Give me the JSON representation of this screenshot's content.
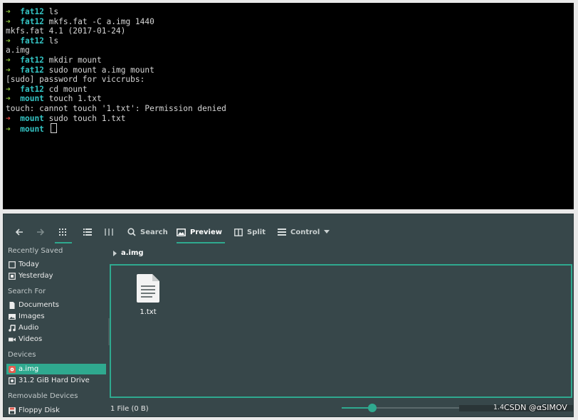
{
  "terminal": {
    "arrow_glyph": "➜",
    "lines": [
      {
        "dir": "fat12",
        "cmd": "ls",
        "arrow_color": "#8ec23e"
      },
      {
        "dir": "fat12",
        "cmd": "mkfs.fat -C a.img 1440",
        "arrow_color": "#8ec23e"
      },
      {
        "out": "mkfs.fat 4.1 (2017-01-24)"
      },
      {
        "dir": "fat12",
        "cmd": "ls",
        "arrow_color": "#8ec23e"
      },
      {
        "out": "a.img"
      },
      {
        "dir": "fat12",
        "cmd": "mkdir mount",
        "arrow_color": "#8ec23e"
      },
      {
        "dir": "fat12",
        "cmd": "sudo mount a.img mount",
        "arrow_color": "#8ec23e"
      },
      {
        "out": "[sudo] password for viccrubs:"
      },
      {
        "dir": "fat12",
        "cmd": "cd mount",
        "arrow_color": "#8ec23e"
      },
      {
        "dir": "mount",
        "cmd": "touch 1.txt",
        "arrow_color": "#8ec23e"
      },
      {
        "out": "touch: cannot touch '1.txt': Permission denied"
      },
      {
        "dir": "mount",
        "cmd": "sudo touch 1.txt",
        "arrow_color": "#e0473f"
      },
      {
        "dir": "mount",
        "cmd": "",
        "arrow_color": "#8ec23e",
        "cursor": true
      }
    ]
  },
  "toolbar": {
    "search_label": "Search",
    "preview_label": "Preview",
    "split_label": "Split",
    "control_label": "Control"
  },
  "sidebar": {
    "recent_header": "Recently Saved",
    "today": "Today",
    "yesterday": "Yesterday",
    "search_header": "Search For",
    "documents": "Documents",
    "images": "Images",
    "audio": "Audio",
    "videos": "Videos",
    "devices_header": "Devices",
    "device_aimg": "a.img",
    "device_hdd": "31.2 GiB Hard Drive",
    "removable_header": "Removable Devices",
    "floppy": "Floppy Disk"
  },
  "location": {
    "current": "a.img"
  },
  "files": [
    {
      "name": "1.txt",
      "icon": "text-file-icon"
    }
  ],
  "status": {
    "count": "1 File (0 B)",
    "free_text": "1.4",
    "zoom_level": 0.25
  },
  "watermark": "CSDN @αSIMOV",
  "colors": {
    "accent": "#2fa98f",
    "panel": "#37474a",
    "terminal_bg": "#000000",
    "dir_cyan": "#34c3c3"
  }
}
